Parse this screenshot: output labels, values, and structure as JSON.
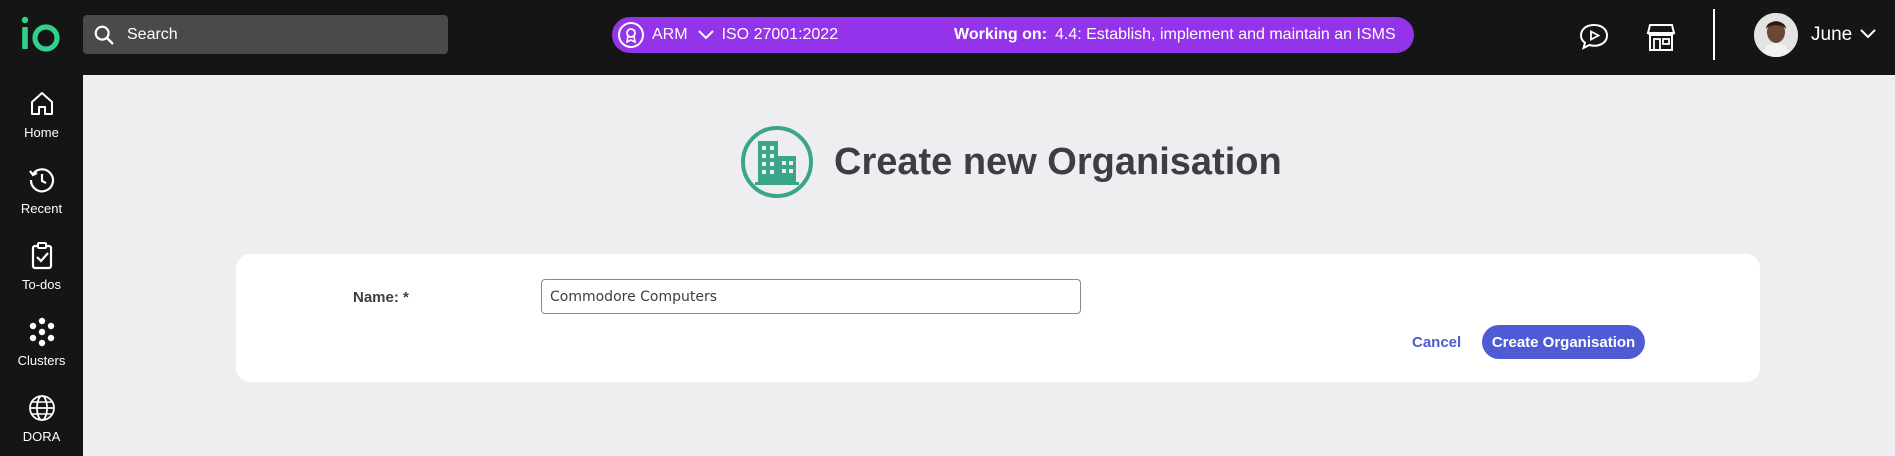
{
  "colors": {
    "topbar_bg": "#151515",
    "accent_purple": "#9333ea",
    "logo_green": "#2fd28a",
    "heading_icon_green": "#3aa58a",
    "primary_button": "#4f5bd5",
    "page_bg": "#eeeef0"
  },
  "header": {
    "logo_icon": "io-logo",
    "search_placeholder": "Search",
    "context": {
      "badge_icon": "award-ribbon-icon",
      "org": "ARM",
      "standard": "ISO 27001:2022",
      "working_on_label": "Working on:",
      "working_on_value": "4.4: Establish, implement and maintain an ISMS"
    },
    "icons": [
      "chat-play-icon",
      "store-icon"
    ],
    "user_name": "June"
  },
  "sidebar": {
    "items": [
      {
        "label": "Home",
        "icon": "home-icon"
      },
      {
        "label": "Recent",
        "icon": "history-icon"
      },
      {
        "label": "To-dos",
        "icon": "clipboard-check-icon"
      },
      {
        "label": "Clusters",
        "icon": "clusters-icon"
      },
      {
        "label": "DORA",
        "icon": "globe-icon"
      }
    ]
  },
  "main": {
    "heading_icon": "building-icon",
    "title": "Create new Organisation",
    "form": {
      "name_label": "Name: *",
      "name_value": "Commodore Computers",
      "cancel_label": "Cancel",
      "submit_label": "Create Organisation"
    }
  }
}
